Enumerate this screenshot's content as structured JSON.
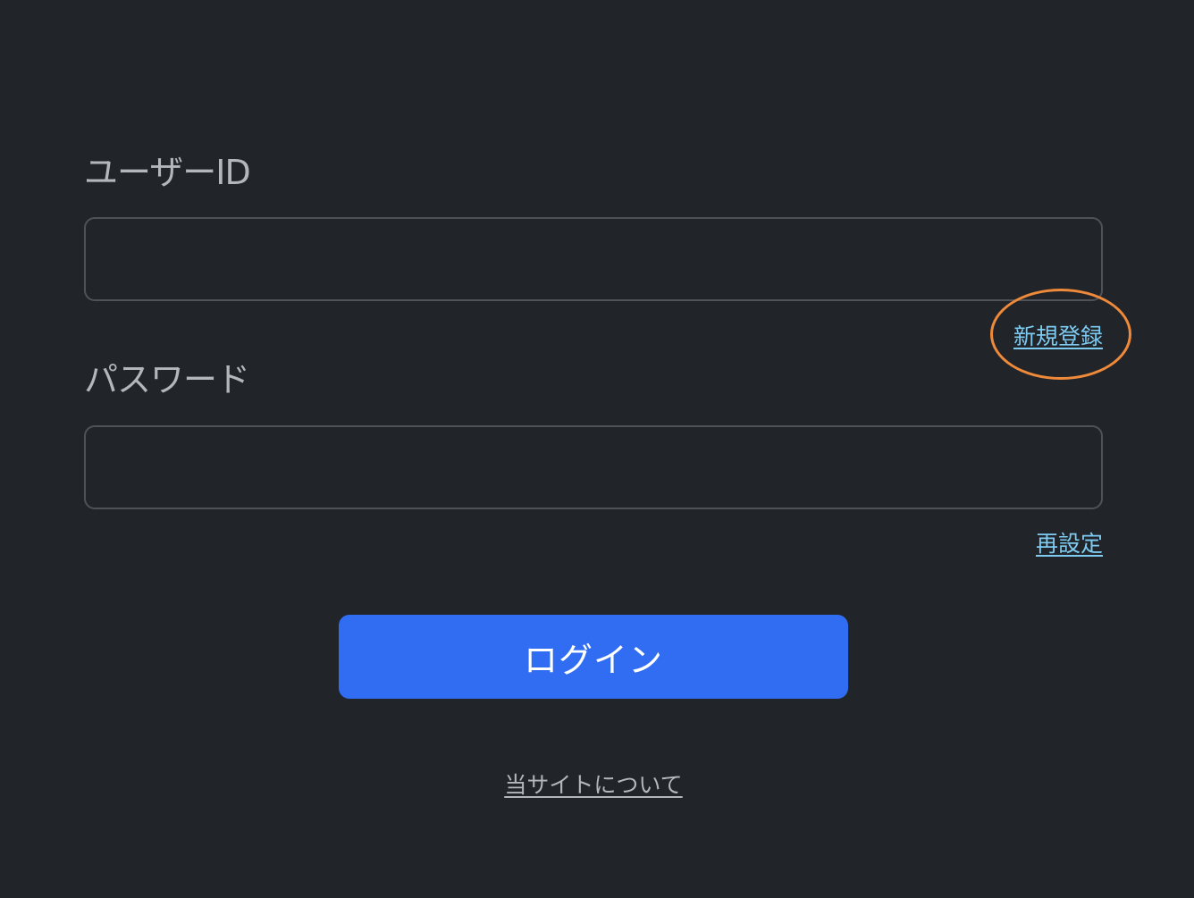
{
  "form": {
    "userid_label": "ユーザーID",
    "userid_value": "",
    "password_label": "パスワード",
    "password_value": "",
    "register_link": "新規登録",
    "reset_link": "再設定",
    "login_button": "ログイン",
    "about_link": "当サイトについて"
  },
  "colors": {
    "background": "#212429",
    "field_border": "#4f5258",
    "link": "#7ecbf2",
    "primary_button": "#316df2",
    "highlight_ring": "#ee8a3a"
  }
}
